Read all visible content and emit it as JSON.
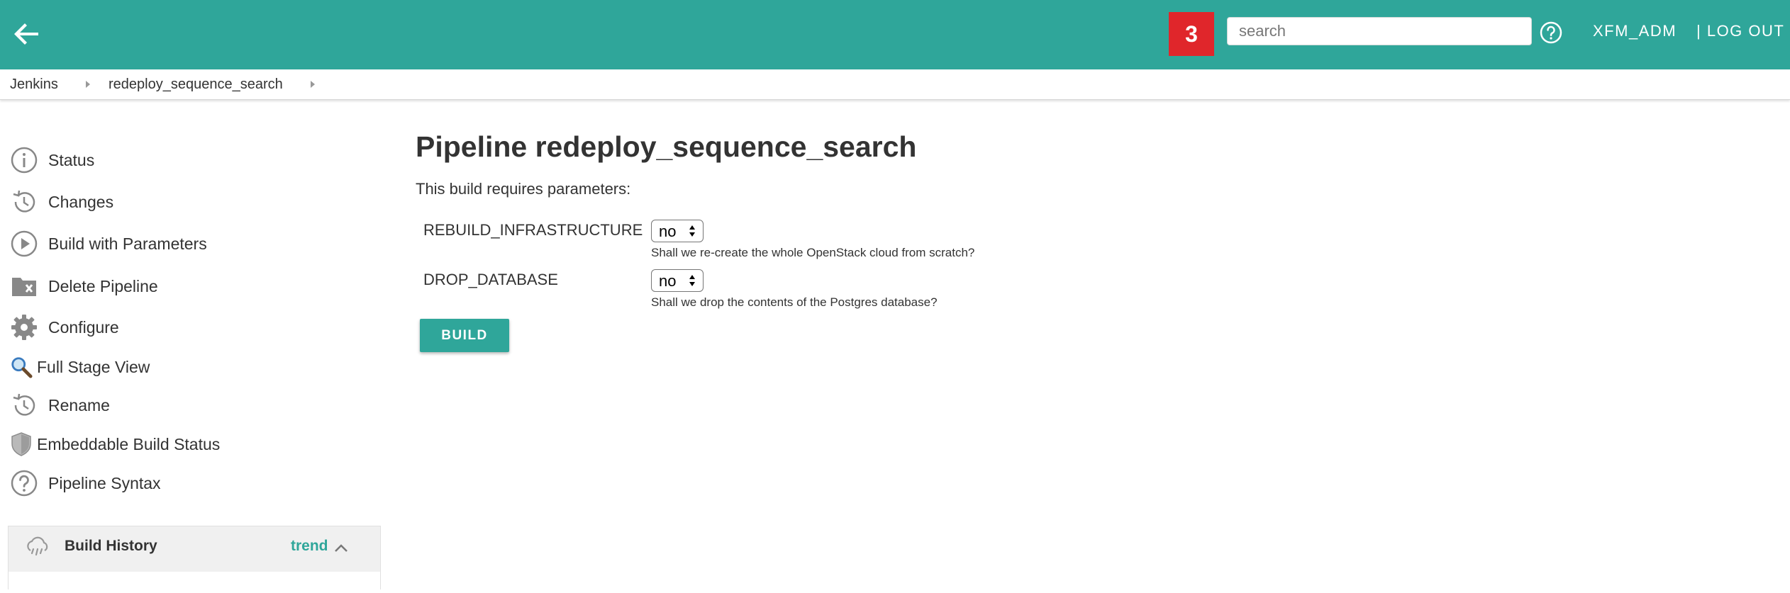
{
  "header": {
    "notification_count": "3",
    "search_placeholder": "search",
    "user": "XFM_ADM",
    "logout": "| LOG OUT"
  },
  "breadcrumb": [
    "Jenkins",
    "redeploy_sequence_search"
  ],
  "sidebar": {
    "items": [
      {
        "label": "Status",
        "icon": "info-icon"
      },
      {
        "label": "Changes",
        "icon": "history-icon"
      },
      {
        "label": "Build with Parameters",
        "icon": "play-icon"
      },
      {
        "label": "Delete Pipeline",
        "icon": "folder-delete-icon"
      },
      {
        "label": "Configure",
        "icon": "gear-icon"
      },
      {
        "label": "Full Stage View",
        "icon": "magnifier-icon"
      },
      {
        "label": "Rename",
        "icon": "history-icon"
      },
      {
        "label": "Embeddable Build Status",
        "icon": "shield-icon"
      },
      {
        "label": "Pipeline Syntax",
        "icon": "help-icon"
      }
    ]
  },
  "build_history": {
    "title": "Build History",
    "trend": "trend"
  },
  "main": {
    "title": "Pipeline redeploy_sequence_search",
    "subtitle": "This build requires parameters:",
    "parameters": [
      {
        "name": "REBUILD_INFRASTRUCTURE",
        "value": "no",
        "description": "Shall we re-create the whole OpenStack cloud from scratch?"
      },
      {
        "name": "DROP_DATABASE",
        "value": "no",
        "description": "Shall we drop the contents of the Postgres database?"
      }
    ],
    "build_button": "BUILD"
  },
  "colors": {
    "header": "#2fa69a",
    "badge": "#e0262b",
    "accent": "#2fa69a"
  }
}
